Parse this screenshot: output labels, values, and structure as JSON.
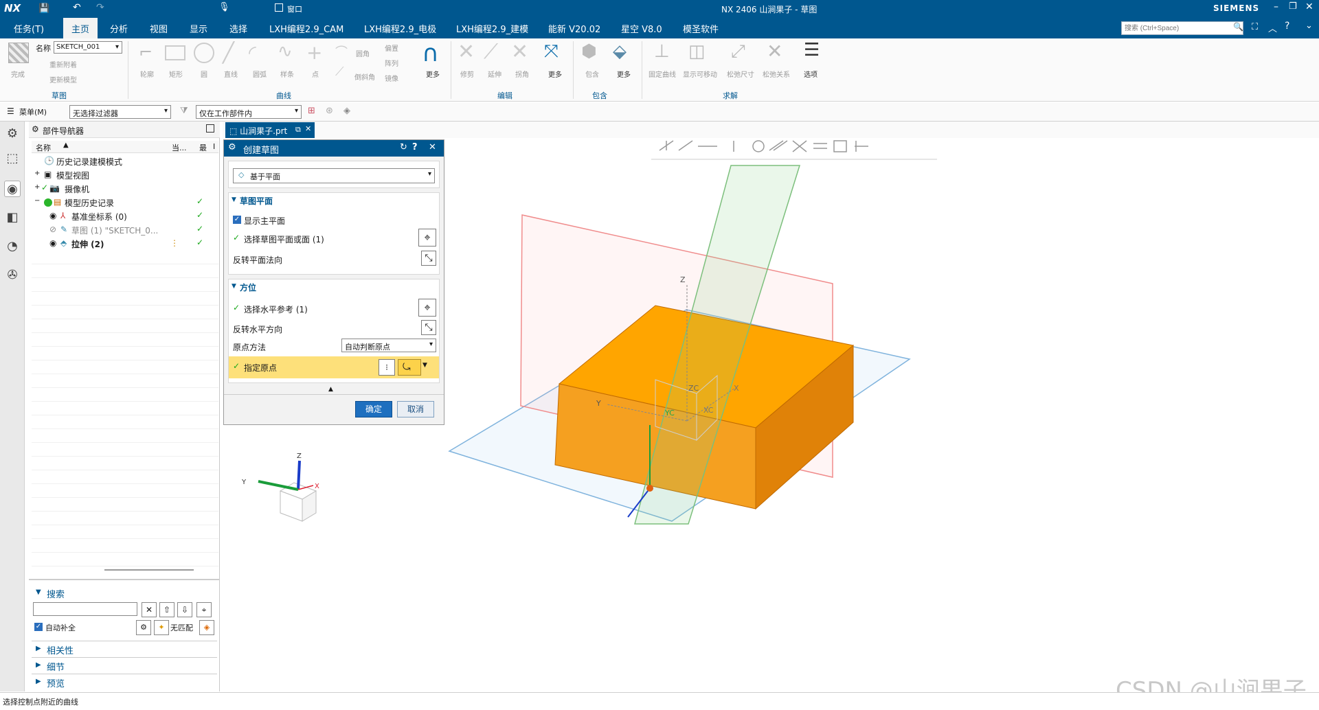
{
  "app": {
    "logo": "NX",
    "window_title": "NX 2406  山涧果子 - 草图",
    "brand": "SIEMENS",
    "window_menu": "窗口",
    "search_placeholder": "搜索 (Ctrl+Space)"
  },
  "menu": {
    "items": [
      "任务(T)",
      "主页",
      "分析",
      "视图",
      "显示",
      "选择",
      "LXH编程2.9_CAM",
      "LXH编程2.9_电极",
      "LXH编程2.9_建模",
      "能新 V20.02",
      "星空 V8.0",
      "模圣软件"
    ]
  },
  "ribbon": {
    "sketch_group": {
      "finish_label": "完成",
      "name_label": "名称",
      "name_value": "SKETCH_001",
      "reattach_label": "重新附着",
      "update_label": "更新模型",
      "group_label": "草图"
    },
    "curve_group": {
      "items": [
        "轮廓",
        "矩形",
        "圆",
        "直线",
        "圆弧",
        "样条",
        "点"
      ],
      "fillet_label": "圆角",
      "chamfer_label": "倒斜角",
      "offset_label": "偏置",
      "pattern_label": "阵列",
      "mirror_label": "镜像",
      "more_label": "更多",
      "group_label": "曲线"
    },
    "edit_group": {
      "items": [
        "修剪",
        "延伸",
        "拐角"
      ],
      "more_label": "更多",
      "group_label": "编辑"
    },
    "include_group": {
      "items": [
        "包含"
      ],
      "more_label": "更多",
      "group_label": "包含"
    },
    "solve_group": {
      "items": [
        "固定曲线",
        "显示可移动",
        "松弛尺寸",
        "松弛关系"
      ],
      "options_label": "选项",
      "group_label": "求解"
    }
  },
  "toolbar2": {
    "menu_label": "菜单(M)",
    "filter_value": "无选择过滤器",
    "scope_value": "仅在工作部件内"
  },
  "navigator": {
    "title": "部件导航器",
    "col_name": "名称",
    "col_current": "当...",
    "col_latest": "最",
    "col_extra": "I",
    "rows": [
      {
        "label": "历史记录建模模式"
      },
      {
        "label": "模型视图"
      },
      {
        "label": "摄像机"
      },
      {
        "label": "模型历史记录"
      },
      {
        "label": "基准坐标系 (0)"
      },
      {
        "label": "草图 (1) \"SKETCH_0..."
      },
      {
        "label": "拉伸 (2)"
      }
    ],
    "search_header": "搜索",
    "autocomplete_label": "自动补全",
    "no_match_label": "无匹配",
    "related_label": "相关性",
    "details_label": "细节",
    "preview_label": "预览"
  },
  "doc_tab": {
    "label": "山涧果子.prt"
  },
  "dialog": {
    "title": "创建草图",
    "type_value": "基于平面",
    "plane_section": "草图平面",
    "show_main_plane": "显示主平面",
    "select_plane": "选择草图平面或面 (1)",
    "reverse_normal": "反转平面法向",
    "orient_section": "方位",
    "select_horizontal": "选择水平参考 (1)",
    "reverse_horizontal": "反转水平方向",
    "origin_method_label": "原点方法",
    "origin_method_value": "自动判断原点",
    "specify_origin": "指定原点",
    "ok_label": "确定",
    "cancel_label": "取消"
  },
  "viewport": {
    "axis_labels": {
      "z": "Z",
      "y": "Y",
      "x": "X",
      "zc": "ZC",
      "yc": "YC",
      "xc": "XC"
    }
  },
  "status": {
    "text": "选择控制点附近的曲线"
  },
  "watermark": "CSDN @山涧果子",
  "colors": {
    "brand": "#00578f",
    "box": "#f5a020",
    "highlight": "#fde07a"
  }
}
